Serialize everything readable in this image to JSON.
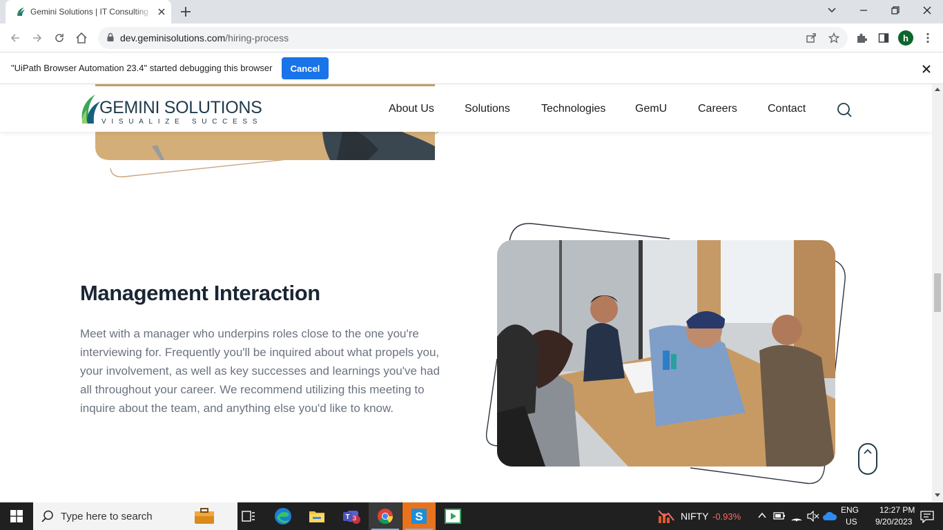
{
  "browser": {
    "tab_title": "Gemini Solutions | IT Consulting",
    "url_host": "dev.geminisolutions.com",
    "url_path": "/hiring-process",
    "profile_initial": "h"
  },
  "infobar": {
    "message": "\"UiPath Browser Automation 23.4\" started debugging this browser",
    "cancel_label": "Cancel"
  },
  "site": {
    "logo_text": "GEMINI SOLUTIONS",
    "logo_tagline": "VISUALIZE SUCCESS",
    "nav": [
      "About Us",
      "Solutions",
      "Technologies",
      "GemU",
      "Careers",
      "Contact"
    ]
  },
  "section": {
    "title": "Management Interaction",
    "body": "Meet with a manager who underpins roles close to the one you're interviewing for. Frequently you'll be inquired about what propels you, your involvement, as well as key successes and learnings you've had all throughout your career. We recommend utilizing this meeting to inquire about the team, and anything else you'd like to know."
  },
  "taskbar": {
    "search_placeholder": "Type here to search",
    "teams_badge": "3",
    "nifty_label": "NIFTY",
    "nifty_change": "-0.93%",
    "lang_top": "ENG",
    "lang_bottom": "US",
    "time": "12:27 PM",
    "date": "9/20/2023"
  },
  "colors": {
    "accent_blue": "#1a73e8",
    "brand_dark": "#1f3a4a",
    "brand_green": "#2e8b57",
    "nifty_negative": "#ff6a6a"
  }
}
